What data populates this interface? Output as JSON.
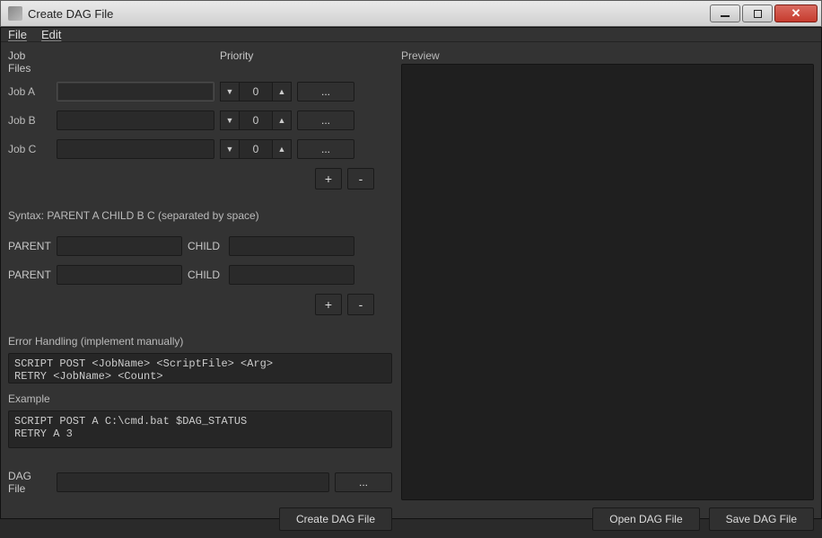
{
  "window": {
    "title": "Create DAG File"
  },
  "menu": {
    "file": "File",
    "edit": "Edit"
  },
  "jobfiles": {
    "header_jobfiles": "Job Files",
    "header_priority": "Priority",
    "rows": [
      {
        "label": "Job A",
        "file": "",
        "priority": "0"
      },
      {
        "label": "Job B",
        "file": "",
        "priority": "0"
      },
      {
        "label": "Job C",
        "file": "",
        "priority": "0"
      }
    ],
    "add": "+",
    "remove": "-",
    "browse": "..."
  },
  "parentchild": {
    "syntax": "Syntax: PARENT A CHILD B C (separated by space)",
    "parent_label": "PARENT",
    "child_label": "CHILD",
    "add": "+",
    "remove": "-"
  },
  "errorhandling": {
    "header": "Error Handling (implement manually)",
    "code": "SCRIPT POST <JobName> <ScriptFile> <Arg>\nRETRY <JobName> <Count>"
  },
  "example": {
    "header": "Example",
    "code": "SCRIPT POST A C:\\cmd.bat $DAG_STATUS\nRETRY A 3"
  },
  "dagfile": {
    "label": "DAG File",
    "value": "",
    "browse": "..."
  },
  "buttons": {
    "create": "Create DAG File",
    "open": "Open DAG File",
    "save": "Save DAG File"
  },
  "preview": {
    "header": "Preview"
  },
  "glyphs": {
    "spin_down": "▼",
    "spin_up": "▲",
    "min": "min",
    "max": "max",
    "close": "✕"
  }
}
